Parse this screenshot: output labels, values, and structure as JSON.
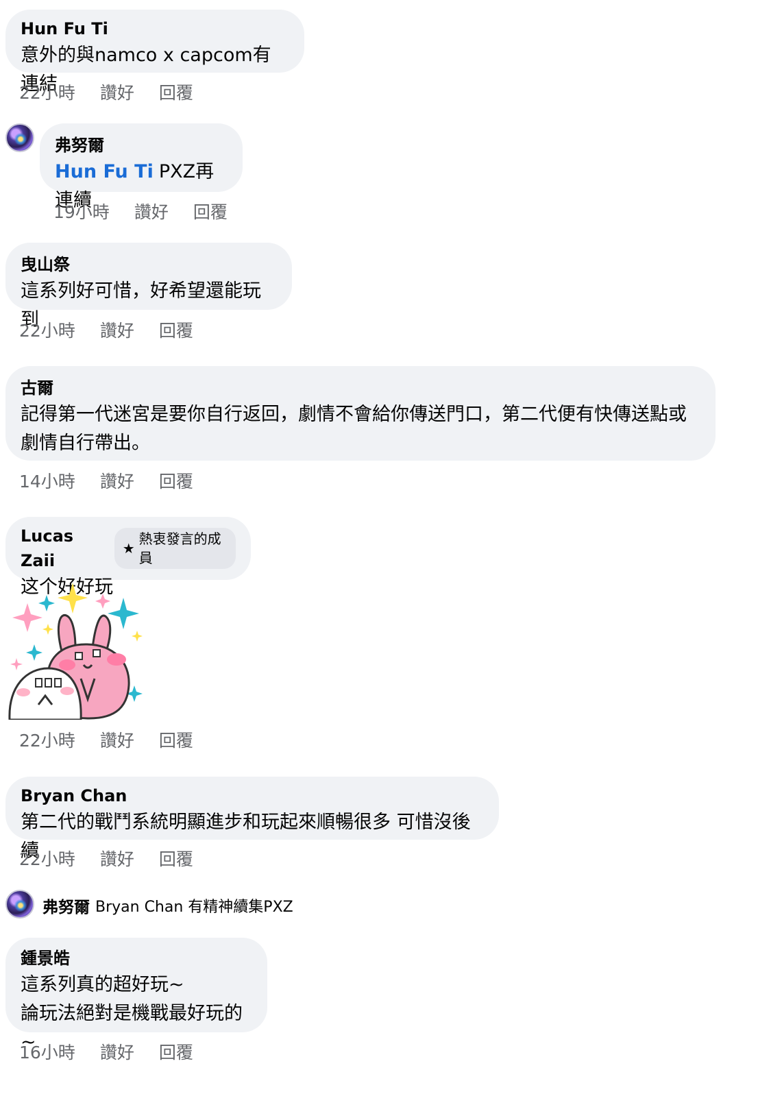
{
  "comments": [
    {
      "author": "Hun Fu Ti",
      "text": "意外的與namco x capcom有連結",
      "time": "22小時",
      "like": "讚好",
      "reply": "回覆"
    },
    {
      "author": "弗努爾",
      "mention": "Hun Fu Ti",
      "text": "PXZ再連續",
      "time": "19小時",
      "like": "讚好",
      "reply": "回覆"
    },
    {
      "author": "曳山祭",
      "text": "這系列好可惜，好希望還能玩到",
      "time": "22小時",
      "like": "讚好",
      "reply": "回覆"
    },
    {
      "author": "古爾",
      "text": "記得第一代迷宮是要你自行返回，劇情不會給你傳送門口，第二代便有快傳送點或\n劇情自行帶出。",
      "time": "14小時",
      "like": "讚好",
      "reply": "回覆"
    },
    {
      "author": "Lucas Zaii",
      "badge": "熱衷發言的成員",
      "text": "这个好好玩",
      "time": "22小時",
      "like": "讚好",
      "reply": "回覆"
    },
    {
      "author": "Bryan Chan",
      "text": "第二代的戰鬥系統明顯進步和玩起來順暢很多 可惜沒後續",
      "time": "22小時",
      "like": "讚好",
      "reply": "回覆"
    },
    {
      "author": "弗努爾",
      "text": "Bryan Chan 有精神續集PXZ"
    },
    {
      "author": "鍾景皓",
      "text": "這系列真的超好玩~\n論玩法絕對是機戰最好玩的~",
      "time": "16小時",
      "like": "讚好",
      "reply": "回覆"
    }
  ]
}
